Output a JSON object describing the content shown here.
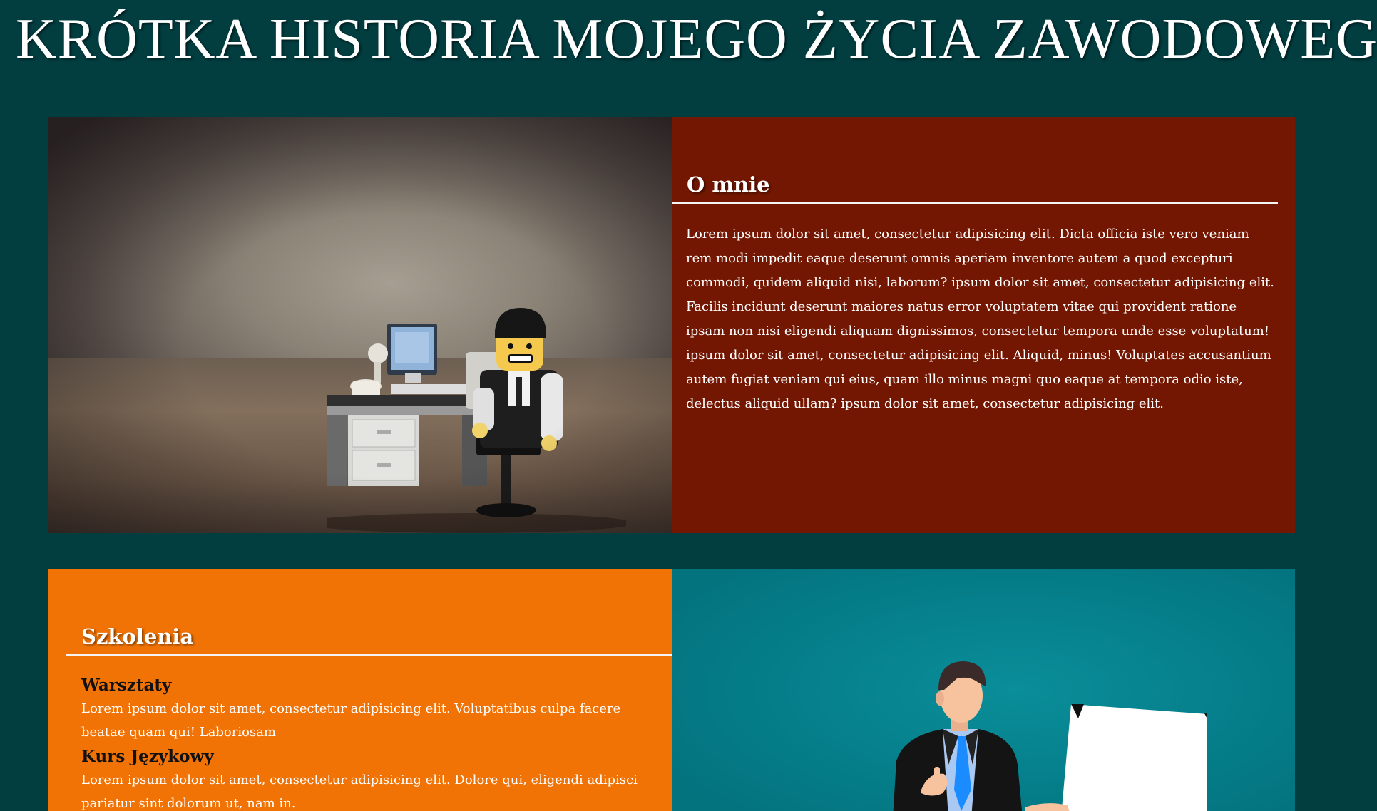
{
  "page": {
    "title": "KRÓTKA HISTORIA MOJEGO ŻYCIA ZAWODOWEGO"
  },
  "about": {
    "heading": "O mnie",
    "text": "Lorem ipsum dolor sit amet, consectetur adipisicing elit. Dicta officia iste vero veniam rem modi impedit eaque deserunt omnis aperiam inventore autem a quod excepturi commodi, quidem aliquid nisi, laborum? ipsum dolor sit amet, consectetur adipisicing elit. Facilis incidunt deserunt maiores natus error voluptatem vitae qui provident ratione ipsam non nisi eligendi aliquam dignissimos, consectetur tempora unde esse voluptatum! ipsum dolor sit amet, consectetur adipisicing elit. Aliquid, minus! Voluptates accusantium autem fugiat veniam qui eius, quam illo minus magni quo eaque at tempora odio iste, delectus aliquid ullam? ipsum dolor sit amet, consectetur adipisicing elit."
  },
  "training": {
    "heading": "Szkolenia",
    "items": [
      {
        "name": "Warsztaty",
        "description": "Lorem ipsum dolor sit amet, consectetur adipisicing elit. Voluptatibus culpa facere beatae quam qui! Laboriosam"
      },
      {
        "name": "Kurs Językowy",
        "description": "Lorem ipsum dolor sit amet, consectetur adipisicing elit. Dolore qui, eligendi adipisci pariatur sint dolorum ut, nam in."
      }
    ]
  },
  "colors": {
    "page_background": "#023d40",
    "about_panel": "#731702",
    "training_panel": "#f17306",
    "illustration_panel": "#057f8b"
  },
  "images": {
    "photo": "lego-minifigure-office-desk-photo",
    "illustration": "businessman-presenting-board-illustration"
  }
}
